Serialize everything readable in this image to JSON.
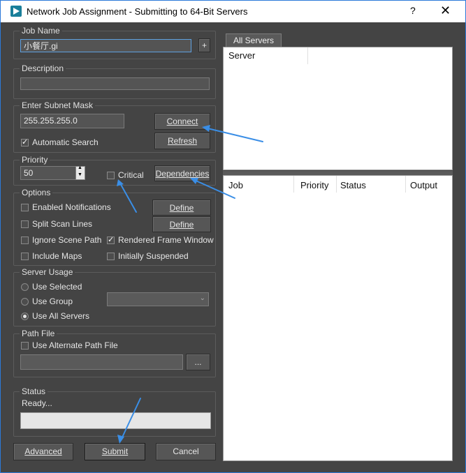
{
  "window": {
    "title": "Network Job Assignment - Submitting to 64-Bit Servers",
    "help": "?",
    "close": "✕"
  },
  "job_name": {
    "label": "Job Name",
    "value": "小餐厅.gi",
    "plus": "+"
  },
  "description": {
    "label": "Description",
    "value": ""
  },
  "subnet": {
    "label": "Enter Subnet Mask",
    "value": "255.255.255.0",
    "connect": "Connect",
    "refresh": "Refresh",
    "auto_search": "Automatic Search"
  },
  "priority": {
    "label": "Priority",
    "value": "50",
    "critical": "Critical",
    "dependencies": "Dependencies"
  },
  "options": {
    "label": "Options",
    "enabled_notifications": "Enabled Notifications",
    "define1": "Define",
    "split_scan_lines": "Split Scan Lines",
    "define2": "Define",
    "ignore_scene_path": "Ignore Scene Path",
    "rendered_frame_window": "Rendered Frame Window",
    "include_maps": "Include Maps",
    "initially_suspended": "Initially Suspended"
  },
  "server_usage": {
    "label": "Server Usage",
    "use_selected": "Use Selected",
    "use_group": "Use Group",
    "use_all_servers": "Use All Servers",
    "group_value": ""
  },
  "path_file": {
    "label": "Path File",
    "use_alternate": "Use Alternate Path File",
    "value": "",
    "browse": "..."
  },
  "status": {
    "label": "Status",
    "text": "Ready..."
  },
  "buttons": {
    "advanced": "Advanced",
    "submit": "Submit",
    "cancel": "Cancel"
  },
  "servers": {
    "tab": "All Servers",
    "col_server": "Server"
  },
  "jobs": {
    "col_job": "Job",
    "col_priority": "Priority",
    "col_status": "Status",
    "col_output": "Output"
  },
  "colors": {
    "accent": "#2b79d9",
    "arrow": "#3a8ee6",
    "panel_bg": "#444444"
  }
}
